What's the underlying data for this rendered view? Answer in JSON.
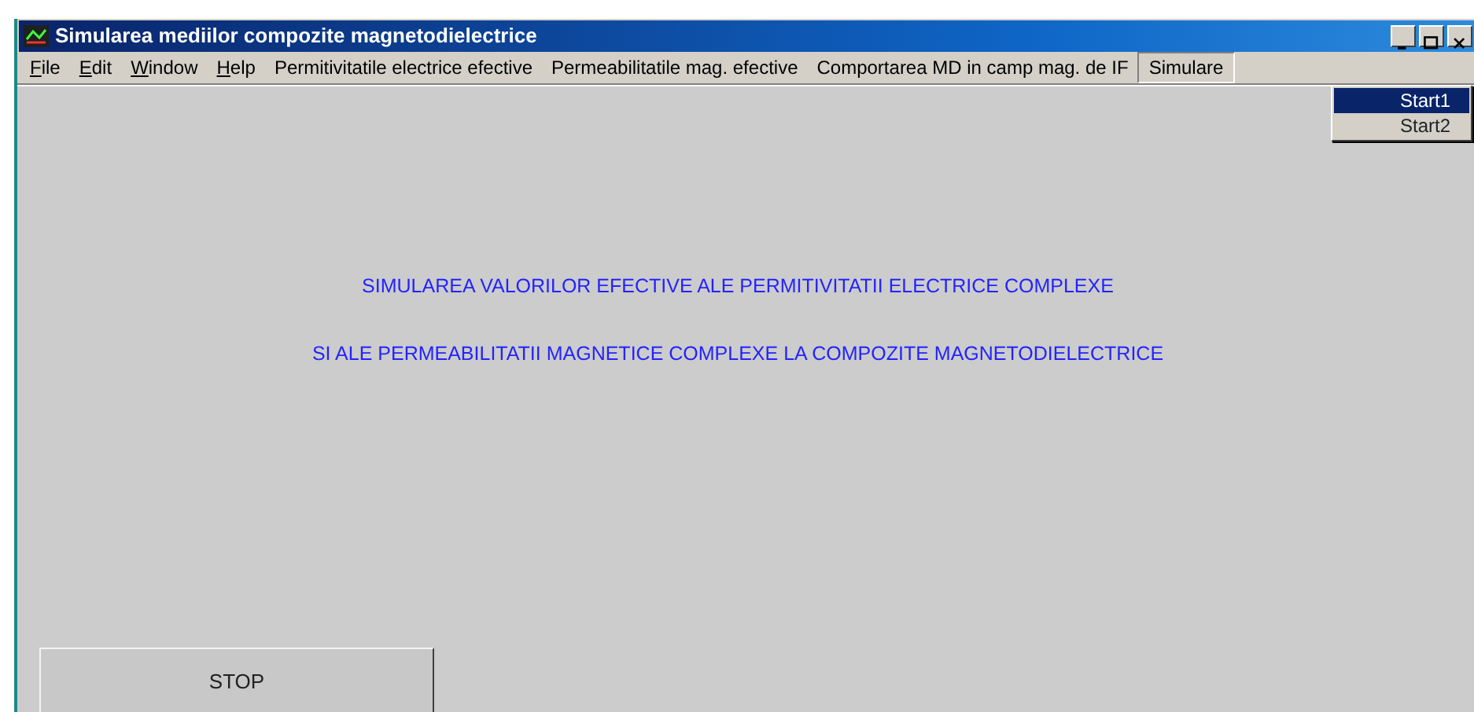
{
  "window": {
    "title": "Simularea mediilor compozite magnetodielectrice"
  },
  "menu": [
    {
      "label": "File",
      "mnemonic": true,
      "selected": false
    },
    {
      "label": "Edit",
      "mnemonic": true,
      "selected": false
    },
    {
      "label": "Window",
      "mnemonic": true,
      "selected": false
    },
    {
      "label": "Help",
      "mnemonic": true,
      "selected": false
    },
    {
      "label": "Permitivitatile electrice efective",
      "mnemonic": false,
      "selected": false
    },
    {
      "label": "Permeabilitatile mag. efective",
      "mnemonic": false,
      "selected": false
    },
    {
      "label": "Comportarea MD in camp mag. de IF",
      "mnemonic": false,
      "selected": false
    },
    {
      "label": "Simulare",
      "mnemonic": false,
      "selected": true
    }
  ],
  "dropdown": [
    {
      "label": "Start1",
      "selected": true
    },
    {
      "label": "Start2",
      "selected": false
    }
  ],
  "headings": [
    "SIMULAREA VALORILOR EFECTIVE ALE PERMITIVITATII ELECTRICE COMPLEXE",
    "SI ALE PERMEABILITATII MAGNETICE COMPLEXE LA COMPOZITE MAGNETODIELECTRICE"
  ],
  "stop_button": {
    "label": "STOP"
  }
}
